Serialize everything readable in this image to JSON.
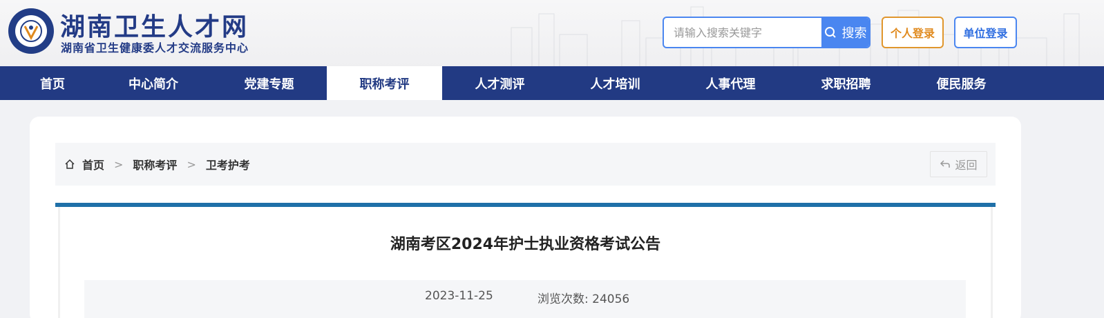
{
  "header": {
    "site_title": "湖南卫生人才网",
    "site_subtitle": "湖南省卫生健康委人才交流服务中心",
    "search_placeholder": "请输入搜索关键字",
    "search_button": "搜索",
    "login_personal": "个人登录",
    "login_unit": "单位登录"
  },
  "nav": {
    "items": [
      {
        "label": "首页"
      },
      {
        "label": "中心简介"
      },
      {
        "label": "党建专题"
      },
      {
        "label": "职称考评"
      },
      {
        "label": "人才测评"
      },
      {
        "label": "人才培训"
      },
      {
        "label": "人事代理"
      },
      {
        "label": "求职招聘"
      },
      {
        "label": "便民服务"
      }
    ],
    "active_item": "职称考评"
  },
  "breadcrumb": {
    "items": [
      "首页",
      "职称考评",
      "卫考护考"
    ],
    "separator": ">",
    "back_label": "返回"
  },
  "article": {
    "title": "湖南考区2024年护士执业资格考试公告",
    "date": "2023-11-25",
    "views": "浏览次数: 24056"
  },
  "colors": {
    "brand_navy": "#223a83",
    "accent_blue": "#4a86f0",
    "accent_orange": "#e08a1e",
    "article_bar": "#1f70a8"
  }
}
